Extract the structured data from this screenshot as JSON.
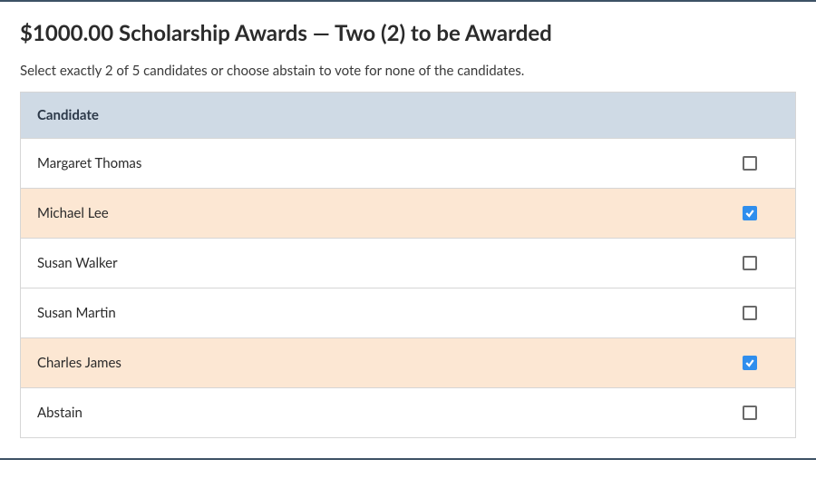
{
  "title": "$1000.00 Scholarship Awards — Two (2) to be Awarded",
  "instructions": "Select exactly 2 of 5 candidates or choose abstain to vote for none of the candidates.",
  "header_label": "Candidate",
  "candidates": [
    {
      "name": "Margaret Thomas",
      "selected": false
    },
    {
      "name": "Michael Lee",
      "selected": true
    },
    {
      "name": "Susan Walker",
      "selected": false
    },
    {
      "name": "Susan Martin",
      "selected": false
    },
    {
      "name": "Charles James",
      "selected": true
    },
    {
      "name": "Abstain",
      "selected": false
    }
  ]
}
